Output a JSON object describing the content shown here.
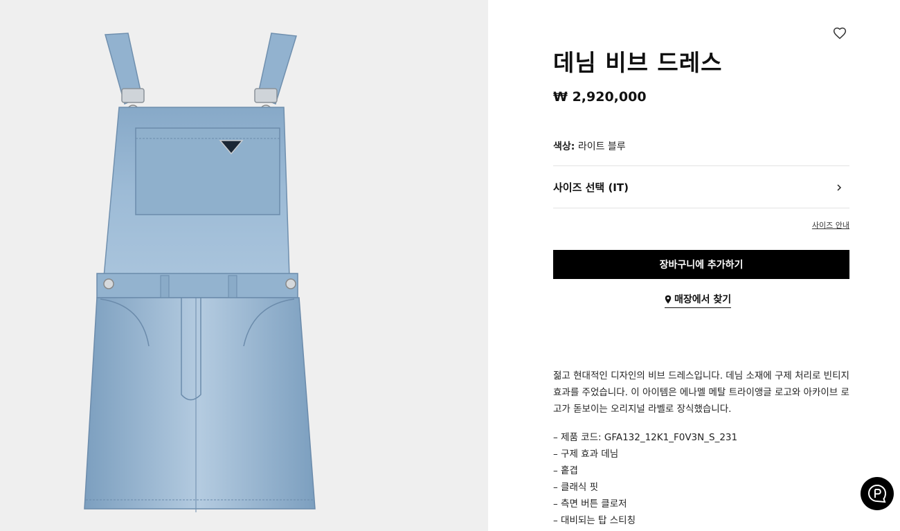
{
  "product": {
    "title": "데님 비브 드레스",
    "price": "₩ 2,920,000",
    "color_label": "색상:",
    "color_value": "라이트 블루",
    "size_select_label": "사이즈 선택 (IT)",
    "size_guide": "사이즈 안내",
    "add_to_cart": "장바구니에 추가하기",
    "find_in_store": "매장에서 찾기",
    "description": "젊고 현대적인 디자인의 비브 드레스입니다. 데님 소재에 구제 처리로 빈티지 효과를 주었습니다. 이 아이템은 에나멜 메탈 트라이앵글 로고와 아카이브 로고가 돋보이는 오리지널 라벨로 장식했습니다.",
    "features": [
      "제품 코드: GFA132_12K1_F0V3N_S_231",
      "구제 효과 데님",
      "홑겹",
      "클래식 핏",
      "측면 버튼 클로저",
      "대비되는 탑 스티칭"
    ]
  },
  "icons": {
    "wishlist": "heart-icon",
    "size_chevron": "chevron-right-icon",
    "store_pin": "location-pin-icon",
    "chat": "chat-icon"
  },
  "colors": {
    "cart_button_bg": "#000000",
    "image_bg": "#efefef",
    "denim": "#8fb0cc"
  }
}
